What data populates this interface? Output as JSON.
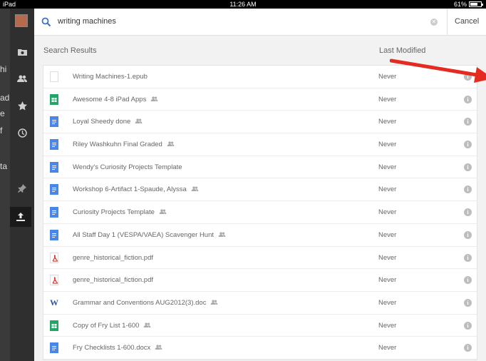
{
  "status": {
    "device": "iPad",
    "time": "11:26 AM",
    "battery": "61%",
    "battery_level": 0.61
  },
  "behind_text": [
    "hi",
    "ad",
    "e",
    "f",
    "ta"
  ],
  "search": {
    "query": "writing machines",
    "cancel_label": "Cancel"
  },
  "headers": {
    "results": "Search Results",
    "modified": "Last Modified"
  },
  "files": [
    {
      "name": "Writing Machines-1.epub",
      "type": "blank",
      "shared": false,
      "modified": "Never"
    },
    {
      "name": "Awesome 4-8 iPad Apps",
      "type": "sheet",
      "shared": true,
      "modified": "Never"
    },
    {
      "name": "Loyal Sheedy done",
      "type": "doc",
      "shared": true,
      "modified": "Never"
    },
    {
      "name": "Riley Washkuhn Final Graded",
      "type": "doc",
      "shared": true,
      "modified": "Never"
    },
    {
      "name": "Wendy's Curiosity Projects Template",
      "type": "doc",
      "shared": false,
      "modified": "Never"
    },
    {
      "name": "Workshop 6-Artifact 1-Spaude, Alyssa",
      "type": "doc",
      "shared": true,
      "modified": "Never"
    },
    {
      "name": "Curiosity Projects Template",
      "type": "doc",
      "shared": true,
      "modified": "Never"
    },
    {
      "name": "All Staff Day 1 (VESPA/VAEA) Scavenger Hunt",
      "type": "doc",
      "shared": true,
      "modified": "Never"
    },
    {
      "name": "genre_historical_fiction.pdf",
      "type": "pdf",
      "shared": false,
      "modified": "Never"
    },
    {
      "name": "genre_historical_fiction.pdf",
      "type": "pdf",
      "shared": false,
      "modified": "Never"
    },
    {
      "name": "Grammar and Conventions AUG2012(3).doc",
      "type": "word",
      "shared": true,
      "modified": "Never"
    },
    {
      "name": "Copy of Fry List 1-600",
      "type": "sheet",
      "shared": true,
      "modified": "Never"
    },
    {
      "name": "Fry Checklists 1-600.docx",
      "type": "doc",
      "shared": true,
      "modified": "Never"
    }
  ],
  "colors": {
    "arrow": "#e52a1f",
    "doc": "#4a86e8",
    "sheet": "#23a566",
    "pdf": "#d93025"
  }
}
